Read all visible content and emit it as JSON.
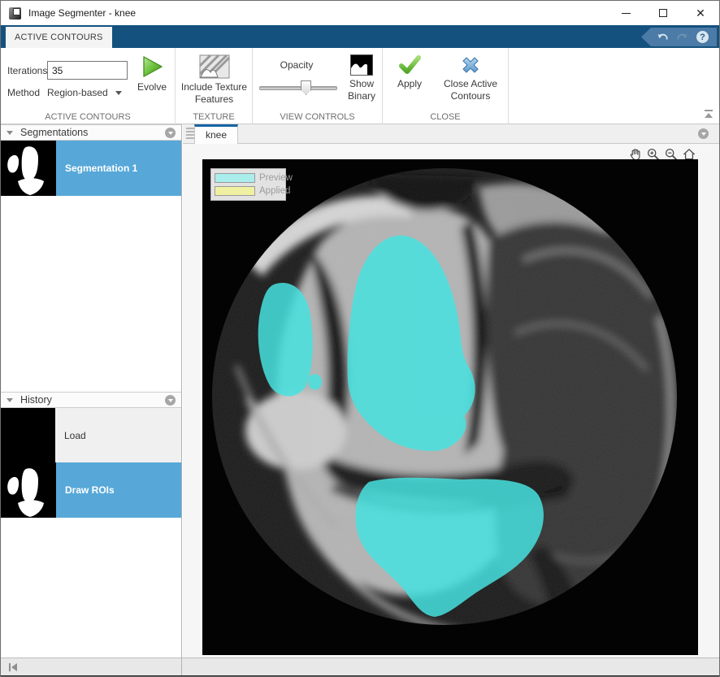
{
  "window": {
    "title": "Image Segmenter - knee"
  },
  "ribbon": {
    "active_tab": "ACTIVE CONTOURS",
    "groups": {
      "active_contours": {
        "label": "ACTIVE CONTOURS",
        "iterations_label": "Iterations",
        "iterations_value": "35",
        "method_label": "Method",
        "method_value": "Region-based",
        "evolve_label": "Evolve"
      },
      "texture": {
        "label": "TEXTURE",
        "include_texture_label": "Include Texture Features"
      },
      "view_controls": {
        "label": "VIEW CONTROLS",
        "opacity_label": "Opacity",
        "opacity_percent": 58,
        "show_binary_label": "Show Binary"
      },
      "close": {
        "label": "CLOSE",
        "apply_label": "Apply",
        "close_label": "Close Active Contours"
      }
    }
  },
  "panels": {
    "segmentations": {
      "title": "Segmentations",
      "items": [
        {
          "label": "Segmentation 1",
          "selected": true
        }
      ]
    },
    "history": {
      "title": "History",
      "items": [
        {
          "label": "Load",
          "selected": false
        },
        {
          "label": "Draw ROIs",
          "selected": true
        }
      ]
    }
  },
  "document": {
    "tab_label": "knee",
    "legend": {
      "preview_label": "Preview",
      "applied_label": "Applied",
      "preview_swatch_style": "background:#a9edec",
      "applied_swatch_style": "background:#f0f0a2"
    }
  },
  "colors": {
    "ribbon_blue": "#14517e",
    "quick_access_blue": "#4b7ba6",
    "selection_blue": "#57a8d8",
    "preview_overlay_cyan": "#47e2e0",
    "legend_preview_swatch": "#a9edec",
    "legend_applied_swatch": "#f0f0a2",
    "active_tab_underline": "#1765a3",
    "evolve_green": "#59b32c",
    "close_x_blue": "#79aedd"
  }
}
